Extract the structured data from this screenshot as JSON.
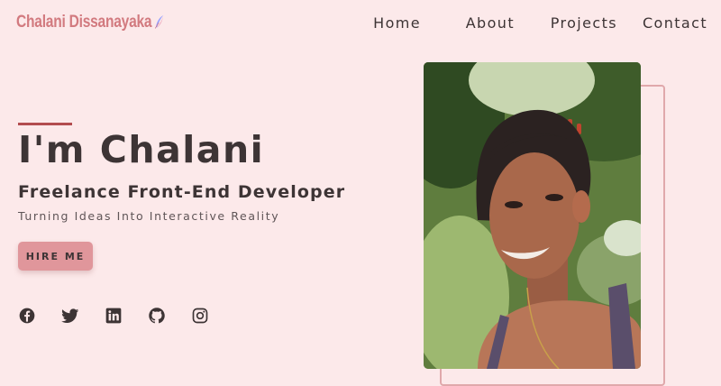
{
  "brand": {
    "name": "Chalani Dissanayaka",
    "accent_color": "#d27a7f",
    "icon": "feather-icon"
  },
  "nav": {
    "items": [
      {
        "label": "Home"
      },
      {
        "label": "About"
      },
      {
        "label": "Projects"
      },
      {
        "label": "Contact"
      }
    ]
  },
  "hero": {
    "title": "I'm Chalani",
    "role": "Freelance Front-End Developer",
    "tagline": "Turning Ideas Into Interactive Reality",
    "cta_label": "HIRE ME",
    "photo_icon": "profile-photo",
    "colors": {
      "background": "#fce9ea",
      "text": "#3d3435",
      "accent_line": "#b34c4f",
      "button": "#e0969b",
      "frame": "#e0a8ab"
    }
  },
  "social": [
    {
      "icon": "facebook-icon"
    },
    {
      "icon": "twitter-icon"
    },
    {
      "icon": "linkedin-icon"
    },
    {
      "icon": "github-icon"
    },
    {
      "icon": "instagram-icon"
    }
  ]
}
